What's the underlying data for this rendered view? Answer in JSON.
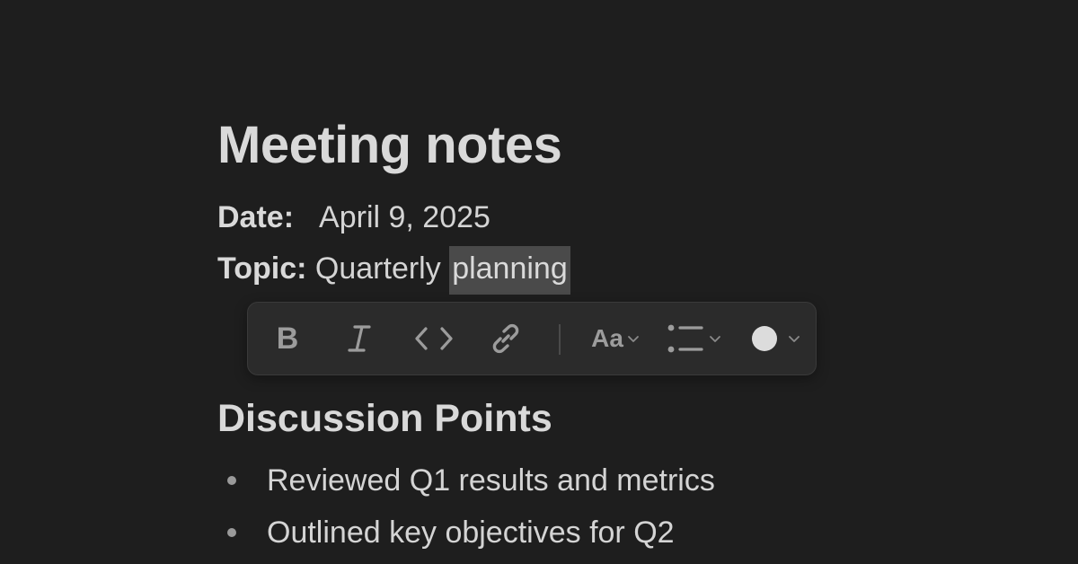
{
  "document": {
    "title": "Meeting notes",
    "date_label": "Date:",
    "date_value": "April 9, 2025",
    "topic_label": "Topic:",
    "topic_value_plain": "Quarterly ",
    "topic_value_selected": "planning"
  },
  "toolbar": {
    "bold_label": "B",
    "text_style_label": "Aa",
    "color_swatch": "#dcdcdc",
    "icons": [
      "bold-icon",
      "italic-icon",
      "code-icon",
      "link-icon",
      "text-style-icon",
      "list-icon",
      "color-icon"
    ]
  },
  "section": {
    "heading": "Discussion Points",
    "bullets": [
      "Reviewed Q1 results and metrics",
      "Outlined key objectives for Q2"
    ]
  },
  "colors": {
    "background": "#1e1e1e",
    "toolbar_bg": "#2b2b2b",
    "selection": "#4a4a4a"
  }
}
